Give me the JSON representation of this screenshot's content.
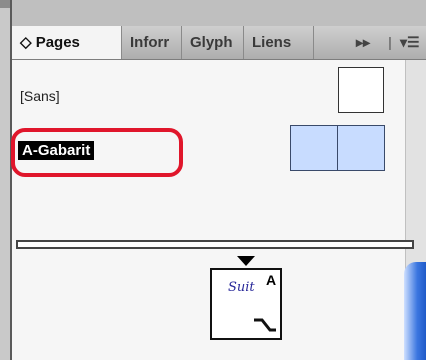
{
  "tabs": [
    {
      "label": "◇ Pages",
      "active": true
    },
    {
      "label": "Inforr",
      "active": false
    },
    {
      "label": "Glyph",
      "active": false
    },
    {
      "label": "Liens",
      "active": false
    }
  ],
  "tab_controls": {
    "more": "▸▸",
    "menu": "▾☰"
  },
  "masters": [
    {
      "label": "[Sans]"
    },
    {
      "label": "A-Gabarit"
    }
  ],
  "document_page": {
    "master_letter": "A"
  },
  "colors": {
    "highlight": "#e0162b",
    "master_thumb_fill": "#c8dcff"
  }
}
